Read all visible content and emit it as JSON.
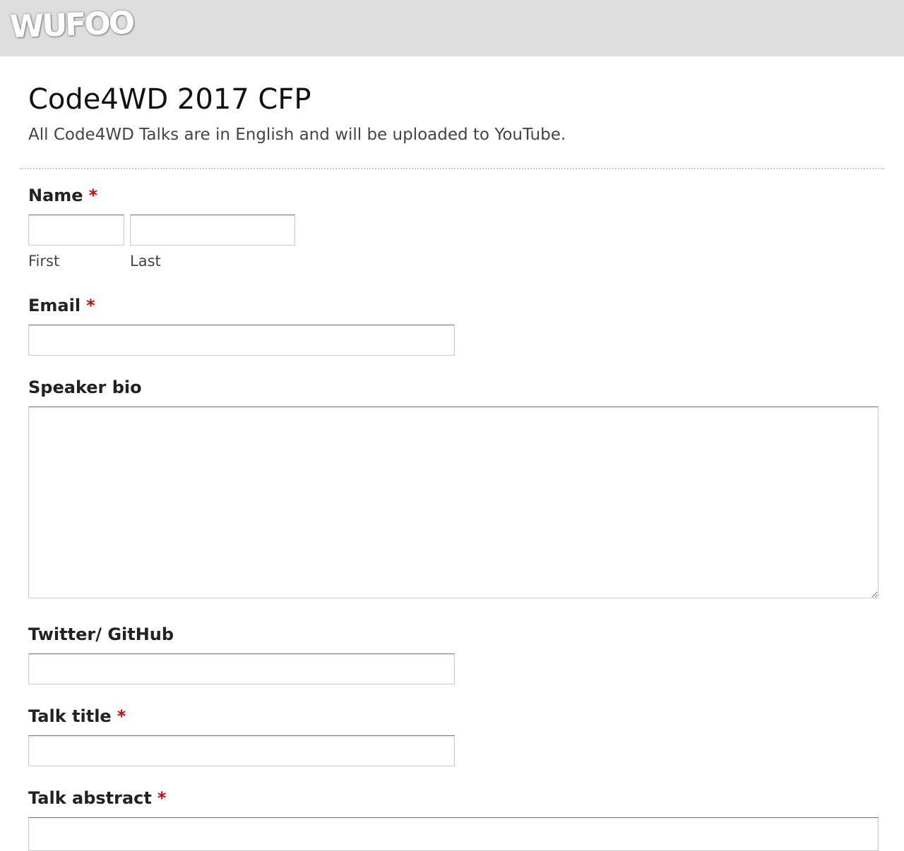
{
  "header": {
    "logo_text": "WUFOO",
    "background": "#dedede"
  },
  "form": {
    "title": "Code4WD 2017 CFP",
    "description": "All Code4WD Talks are in English and will be uploaded to YouTube.",
    "required_marker": "*",
    "required_color": "#df0000",
    "fields": {
      "name": {
        "label": "Name",
        "first_sublabel": "First",
        "last_sublabel": "Last",
        "first_value": "",
        "last_value": ""
      },
      "email": {
        "label": "Email",
        "value": ""
      },
      "speaker_bio": {
        "label": "Speaker bio",
        "value": ""
      },
      "twitter_github": {
        "label": "Twitter/ GitHub",
        "value": ""
      },
      "talk_title": {
        "label": "Talk title",
        "value": ""
      },
      "talk_abstract": {
        "label": "Talk abstract",
        "value": ""
      }
    }
  }
}
